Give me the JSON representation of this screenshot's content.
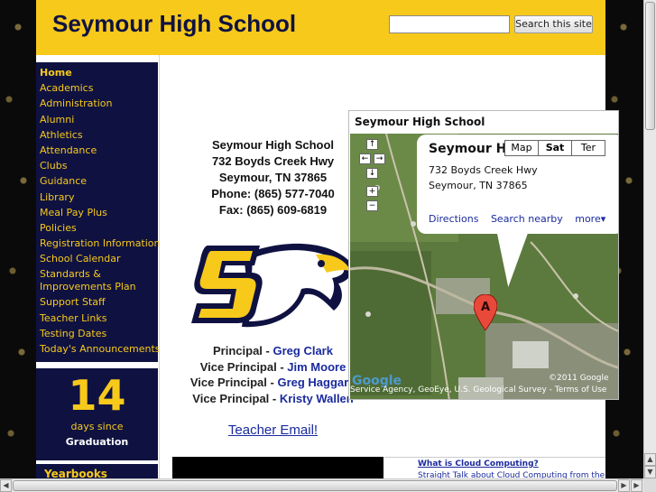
{
  "header": {
    "site_title": "Seymour High School",
    "search_placeholder": "",
    "search_button": "Search this site"
  },
  "nav": {
    "items": [
      {
        "label": "Home",
        "active": true
      },
      {
        "label": "Academics"
      },
      {
        "label": "Administration"
      },
      {
        "label": "Alumni"
      },
      {
        "label": "Athletics"
      },
      {
        "label": "Attendance"
      },
      {
        "label": "Clubs"
      },
      {
        "label": "Guidance"
      },
      {
        "label": "Library"
      },
      {
        "label": "Meal Pay Plus"
      },
      {
        "label": "Policies"
      },
      {
        "label": "Registration Information"
      },
      {
        "label": "School Calendar"
      },
      {
        "label": "Standards & Improvements Plan"
      },
      {
        "label": "Support Staff"
      },
      {
        "label": "Teacher Links"
      },
      {
        "label": "Testing Dates"
      },
      {
        "label": "Today's Announcements"
      }
    ]
  },
  "countdown": {
    "number": "14",
    "text": "days since",
    "event": "Graduation"
  },
  "yearbooks": {
    "label": "Yearbooks"
  },
  "contact": {
    "name": "Seymour High School",
    "street": "732 Boyds Creek Hwy",
    "city": "Seymour, TN 37865",
    "phone": "Phone: (865) 577-7040",
    "fax": "Fax: (865) 609-6819"
  },
  "staff": [
    {
      "role": "Principal - ",
      "name": "Greg Clark"
    },
    {
      "role": "Vice Principal - ",
      "name": "Jim Moore"
    },
    {
      "role": "Vice Principal - ",
      "name": "Greg Haggard"
    },
    {
      "role": "Vice Principal - ",
      "name": "Kristy Wallen"
    }
  ],
  "teacher_email": "Teacher Email!",
  "map": {
    "title": "Seymour High School",
    "bubble_name": "Seymour Hig",
    "bubble_addr1": "732 Boyds Creek Hwy",
    "bubble_addr2": "Seymour, TN 37865",
    "links": [
      "Directions",
      "Search nearby",
      "more▾"
    ],
    "types": [
      {
        "label": "Map"
      },
      {
        "label": "Sat",
        "selected": true
      },
      {
        "label": "Ter"
      }
    ],
    "marker_label": "A",
    "copyright": "©2011 Google",
    "attribution": "Service Agency, GeoEye, U.S. Geological Survey - Terms of Use",
    "logo": "Google",
    "controls": [
      "↑",
      "←",
      "→",
      "↓",
      "+",
      "−"
    ]
  },
  "news": {
    "title": "What is Cloud Computing?",
    "description": "Straight Talk about Cloud Computing from the"
  },
  "colors": {
    "navy": "#0f1241",
    "gold": "#f7c91b",
    "link": "#1a2a9e"
  }
}
